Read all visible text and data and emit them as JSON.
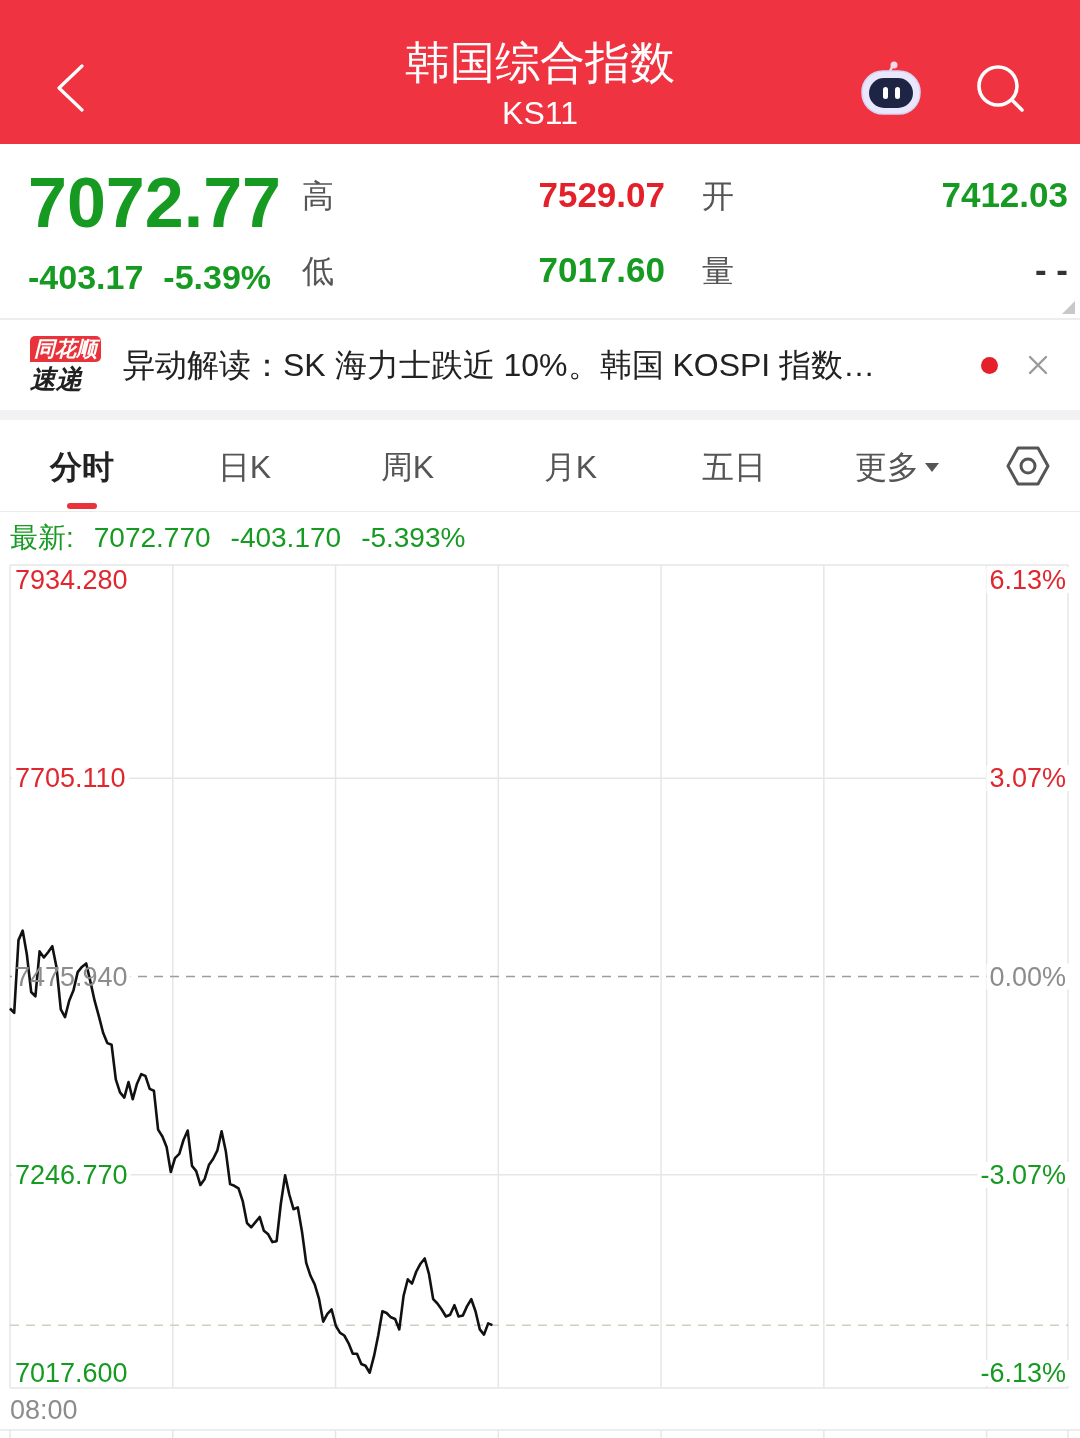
{
  "header": {
    "title": "韩国综合指数",
    "code": "KS11"
  },
  "quote": {
    "price": "7072.77",
    "change": "-403.17",
    "change_pct": "-5.39%",
    "color": "#169a22",
    "stats": [
      {
        "label": "高",
        "value": "7529.07",
        "color": "#e4212b"
      },
      {
        "label": "开",
        "value": "7412.03",
        "color": "#169a22"
      },
      {
        "label": "低",
        "value": "7017.60",
        "color": "#169a22"
      },
      {
        "label": "量",
        "value": "- -",
        "color": "#333333"
      }
    ]
  },
  "news": {
    "logo_top": "同花顺",
    "logo_bottom": "速递",
    "headline": "异动解读：SK 海力士跌近 10%。韩国 KOSPI 指数…",
    "unread": true
  },
  "tabs": [
    {
      "label": "分时",
      "selected": true,
      "dropdown": false
    },
    {
      "label": "日K",
      "selected": false,
      "dropdown": false
    },
    {
      "label": "周K",
      "selected": false,
      "dropdown": false
    },
    {
      "label": "月K",
      "selected": false,
      "dropdown": false
    },
    {
      "label": "五日",
      "selected": false,
      "dropdown": false
    },
    {
      "label": "更多",
      "selected": false,
      "dropdown": true
    }
  ],
  "chart": {
    "latest": {
      "label": "最新:",
      "price": "7072.770",
      "change": "-403.170",
      "change_pct": "-5.393%",
      "color": "#169a22"
    },
    "chart_data": {
      "type": "line",
      "ylim": [
        7000.3,
        7951.6
      ],
      "yticks": [
        {
          "value": 7934.28,
          "label": "7934.280"
        },
        {
          "value": 7705.11,
          "label": "7705.110"
        },
        {
          "value": 7475.94,
          "label": "7475.940"
        },
        {
          "value": 7246.77,
          "label": "7246.770"
        },
        {
          "value": 7017.6,
          "label": "7017.600"
        }
      ],
      "values": [
        7439,
        7434,
        7518,
        7529,
        7501,
        7458,
        7453,
        7505,
        7498,
        7504,
        7511,
        7486,
        7438,
        7429,
        7448,
        7460,
        7481,
        7487,
        7491,
        7470,
        7448,
        7430,
        7411,
        7399,
        7397,
        7357,
        7342,
        7336,
        7354,
        7334,
        7352,
        7363,
        7361,
        7346,
        7344,
        7299,
        7291,
        7279,
        7250,
        7266,
        7271,
        7287,
        7298,
        7257,
        7251,
        7235,
        7242,
        7258,
        7265,
        7275,
        7297,
        7274,
        7236,
        7234,
        7231,
        7216,
        7191,
        7186,
        7192,
        7198,
        7182,
        7178,
        7169,
        7170,
        7213,
        7246,
        7224,
        7207,
        7209,
        7181,
        7145,
        7130,
        7120,
        7104,
        7077,
        7086,
        7091,
        7072,
        7064,
        7061,
        7052,
        7040,
        7040,
        7028,
        7026,
        7018,
        7037,
        7061,
        7089,
        7087,
        7082,
        7080,
        7068,
        7107,
        7126,
        7121,
        7135,
        7144,
        7150,
        7132,
        7103,
        7098,
        7091,
        7083,
        7085,
        7096,
        7083,
        7084,
        7095,
        7103,
        7089,
        7068,
        7062,
        7075,
        7073,
        null,
        null,
        null,
        null,
        null,
        null,
        null,
        null,
        null,
        null,
        null,
        null,
        null,
        null,
        null,
        null,
        null,
        null,
        null,
        null,
        null,
        null,
        null,
        null,
        null,
        null,
        null,
        null,
        null,
        null,
        null,
        null,
        null,
        null,
        null,
        null,
        null,
        null,
        null,
        null,
        null,
        null,
        null,
        null,
        null,
        null,
        null,
        null,
        null,
        null,
        null,
        null,
        null,
        null,
        null,
        null,
        null,
        null,
        null,
        null,
        null,
        null,
        null,
        null,
        null,
        null,
        null,
        null,
        null,
        null,
        null,
        null,
        null,
        null,
        null,
        null,
        null,
        null,
        null,
        null,
        null,
        null,
        null,
        null,
        null,
        null,
        null,
        null,
        null,
        null,
        null,
        null,
        null,
        null,
        null,
        null,
        null,
        null,
        null,
        null,
        null,
        null,
        null,
        null,
        null,
        null,
        null,
        null,
        null,
        null,
        null,
        null,
        null,
        null,
        null,
        null,
        null,
        null,
        null,
        null,
        null,
        null,
        null,
        null,
        null,
        null,
        null,
        null,
        null,
        null,
        null,
        null,
        null,
        null,
        null,
        null
      ],
      "ref_lines": [
        {
          "axis": "y",
          "value": 7475.94,
          "color": "#9c9c9c"
        },
        {
          "axis": "y",
          "value": 7072.77,
          "color": "#cfcfc2"
        }
      ],
      "annotations": [
        {
          "text": "08:00"
        }
      ]
    },
    "percent_labels": [
      "6.13%",
      "3.07%",
      "0.00%",
      "-3.07%",
      "-6.13%"
    ]
  }
}
